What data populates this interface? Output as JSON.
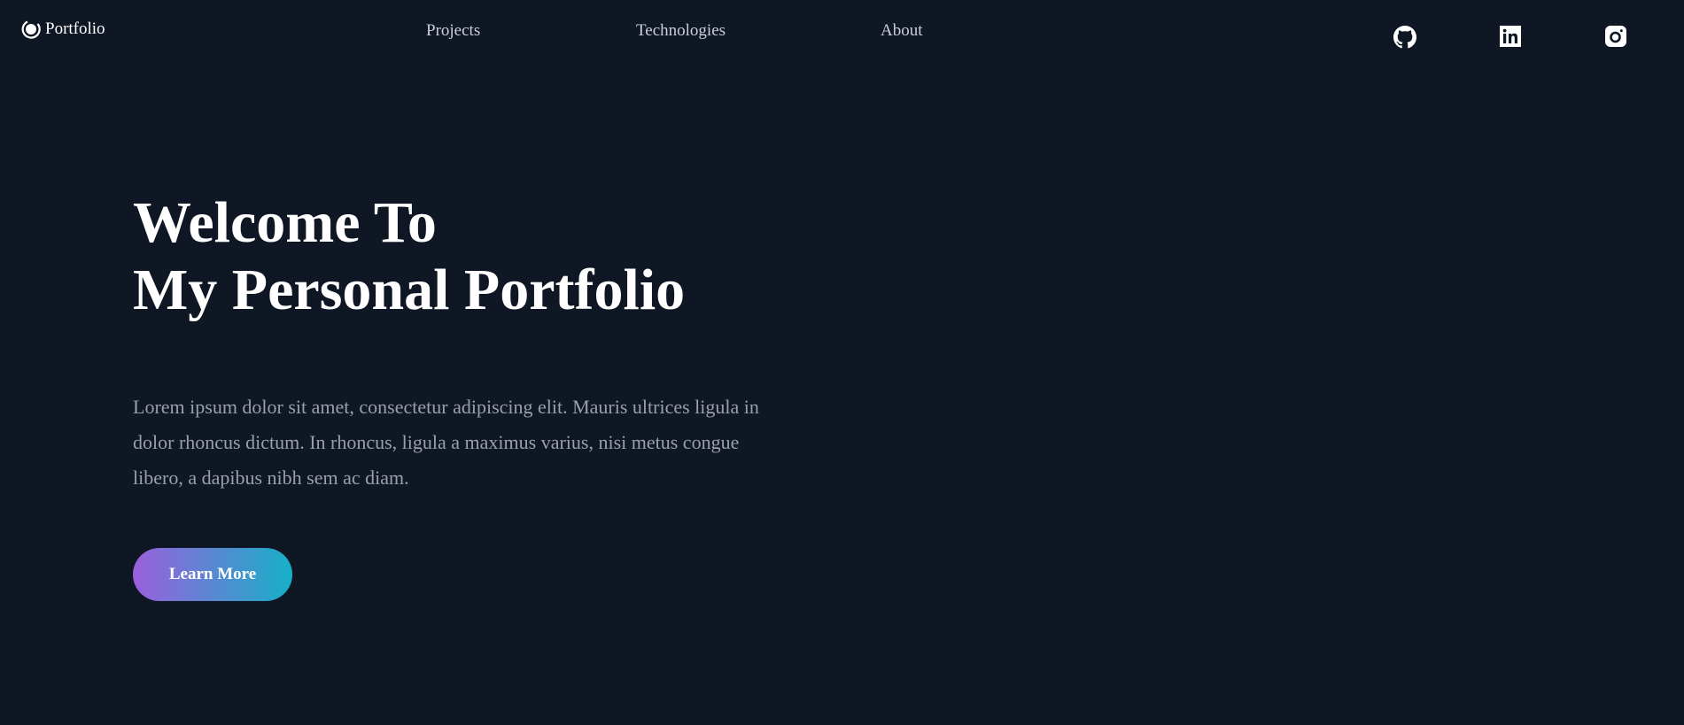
{
  "header": {
    "logo_text": "Portfolio",
    "nav": [
      {
        "label": "Projects"
      },
      {
        "label": "Technologies"
      },
      {
        "label": "About"
      }
    ],
    "social_icons": [
      "github-icon",
      "linkedin-icon",
      "instagram-icon"
    ]
  },
  "hero": {
    "title_line1": "Welcome To",
    "title_line2": "My Personal Portfolio",
    "description": "Lorem ipsum dolor sit amet, consectetur adipiscing elit. Mauris ultrices ligula in dolor rhoncus dictum. In rhoncus, ligula a maximus varius, nisi metus congue libero, a dapibus nibh sem ac diam.",
    "button_label": "Learn More"
  },
  "colors": {
    "background": "#0f1724",
    "gradient_start": "#9b5fdc",
    "gradient_end": "#17b0c8"
  }
}
